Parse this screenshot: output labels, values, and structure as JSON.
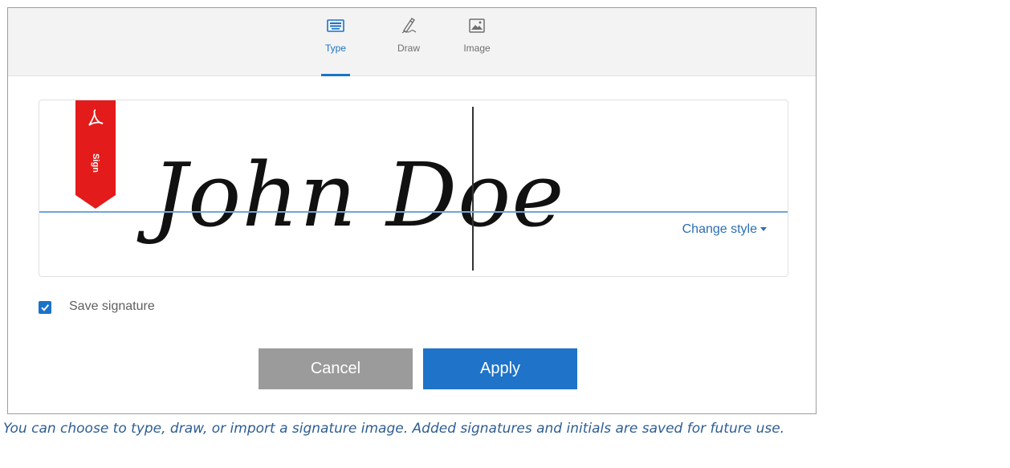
{
  "tabs": [
    {
      "label": "Type",
      "icon": "keyboard-icon",
      "active": true
    },
    {
      "label": "Draw",
      "icon": "pen-icon",
      "active": false
    },
    {
      "label": "Image",
      "icon": "image-icon",
      "active": false
    }
  ],
  "signature": {
    "text": "John Doe",
    "sign_here_label": "Sign",
    "change_style_label": "Change style"
  },
  "save_signature": {
    "label": "Save signature",
    "checked": true
  },
  "buttons": {
    "cancel_label": "Cancel",
    "apply_label": "Apply"
  },
  "caption": "You can choose to type, draw, or import a signature image. Added signatures and initials are saved for future use.",
  "colors": {
    "accent": "#1a73c8",
    "sign_flag": "#e41b1b",
    "cancel_bg": "#9b9b9b",
    "caption_text": "#2e5e93"
  }
}
